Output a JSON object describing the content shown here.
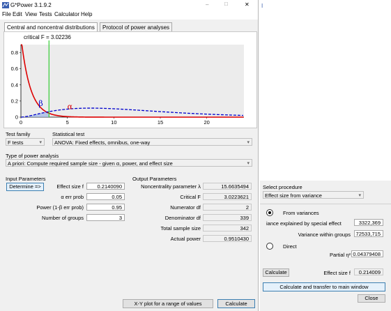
{
  "window": {
    "title": "G*Power 3.1.9.2",
    "controls": {
      "minimize": "–",
      "maximize": "□",
      "close": "✕"
    }
  },
  "menu": [
    "File",
    "Edit",
    "View",
    "Tests",
    "Calculator",
    "Help"
  ],
  "tabs": [
    "Central and noncentral distributions",
    "Protocol of power analyses"
  ],
  "plot": {
    "critical_label": "critical F = 3.02236",
    "critical_value": 3.02236,
    "y_ticks": [
      "0",
      "0.2",
      "0.4",
      "0.6",
      "0.8"
    ],
    "x_ticks": [
      "0",
      "5",
      "10",
      "15",
      "20"
    ],
    "beta_label": "β",
    "alpha_label": "α",
    "colors": {
      "central": "#dd0000",
      "noncentral": "#0000cc",
      "critical": "#33cc33"
    }
  },
  "test_family": {
    "label": "Test family",
    "value": "F tests"
  },
  "statistical_test": {
    "label": "Statistical test",
    "value": "ANOVA: Fixed effects, omnibus, one-way"
  },
  "power_analysis": {
    "label": "Type of power analysis",
    "value": "A priori: Compute required sample size - given α, power, and effect size"
  },
  "input": {
    "title": "Input Parameters",
    "determine_label": "Determine =>",
    "effect_size": {
      "label": "Effect size f",
      "value": "0.2140090"
    },
    "alpha": {
      "label": "α err prob",
      "value": "0.05"
    },
    "power": {
      "label": "Power (1-β err prob)",
      "value": "0.95"
    },
    "groups": {
      "label": "Number of groups",
      "value": "3"
    }
  },
  "output": {
    "title": "Output Parameters",
    "ncp": {
      "label": "Noncentrality parameter λ",
      "value": "15.6635494"
    },
    "critical_f": {
      "label": "Critical F",
      "value": "3.0223621"
    },
    "numerator_df": {
      "label": "Numerator df",
      "value": "2"
    },
    "denominator_df": {
      "label": "Denominator df",
      "value": "339"
    },
    "total_n": {
      "label": "Total sample size",
      "value": "342"
    },
    "actual_power": {
      "label": "Actual power",
      "value": "0.9510430"
    }
  },
  "bottom_buttons": {
    "xy_plot": "X-Y plot for a range of values",
    "calculate": "Calculate"
  },
  "side": {
    "cursor_text": "I",
    "select_procedure": {
      "label": "Select procedure",
      "value": "Effect size from variance"
    },
    "from_variances": {
      "label": "From variances",
      "selected": true
    },
    "variance_special": {
      "label": "iance explained by special effect",
      "value": "3322,369"
    },
    "variance_within": {
      "label": "Variance within groups",
      "value": "72533,715"
    },
    "direct": {
      "label": "Direct",
      "selected": false
    },
    "partial_eta": {
      "label": "Partial η²",
      "value": "0.04379408"
    },
    "calculate_label": "Calculate",
    "effect_size_f": {
      "label": "Effect size f",
      "value": "0.214009"
    },
    "transfer_label": "Calculate and transfer to main window",
    "close_label": "Close"
  }
}
